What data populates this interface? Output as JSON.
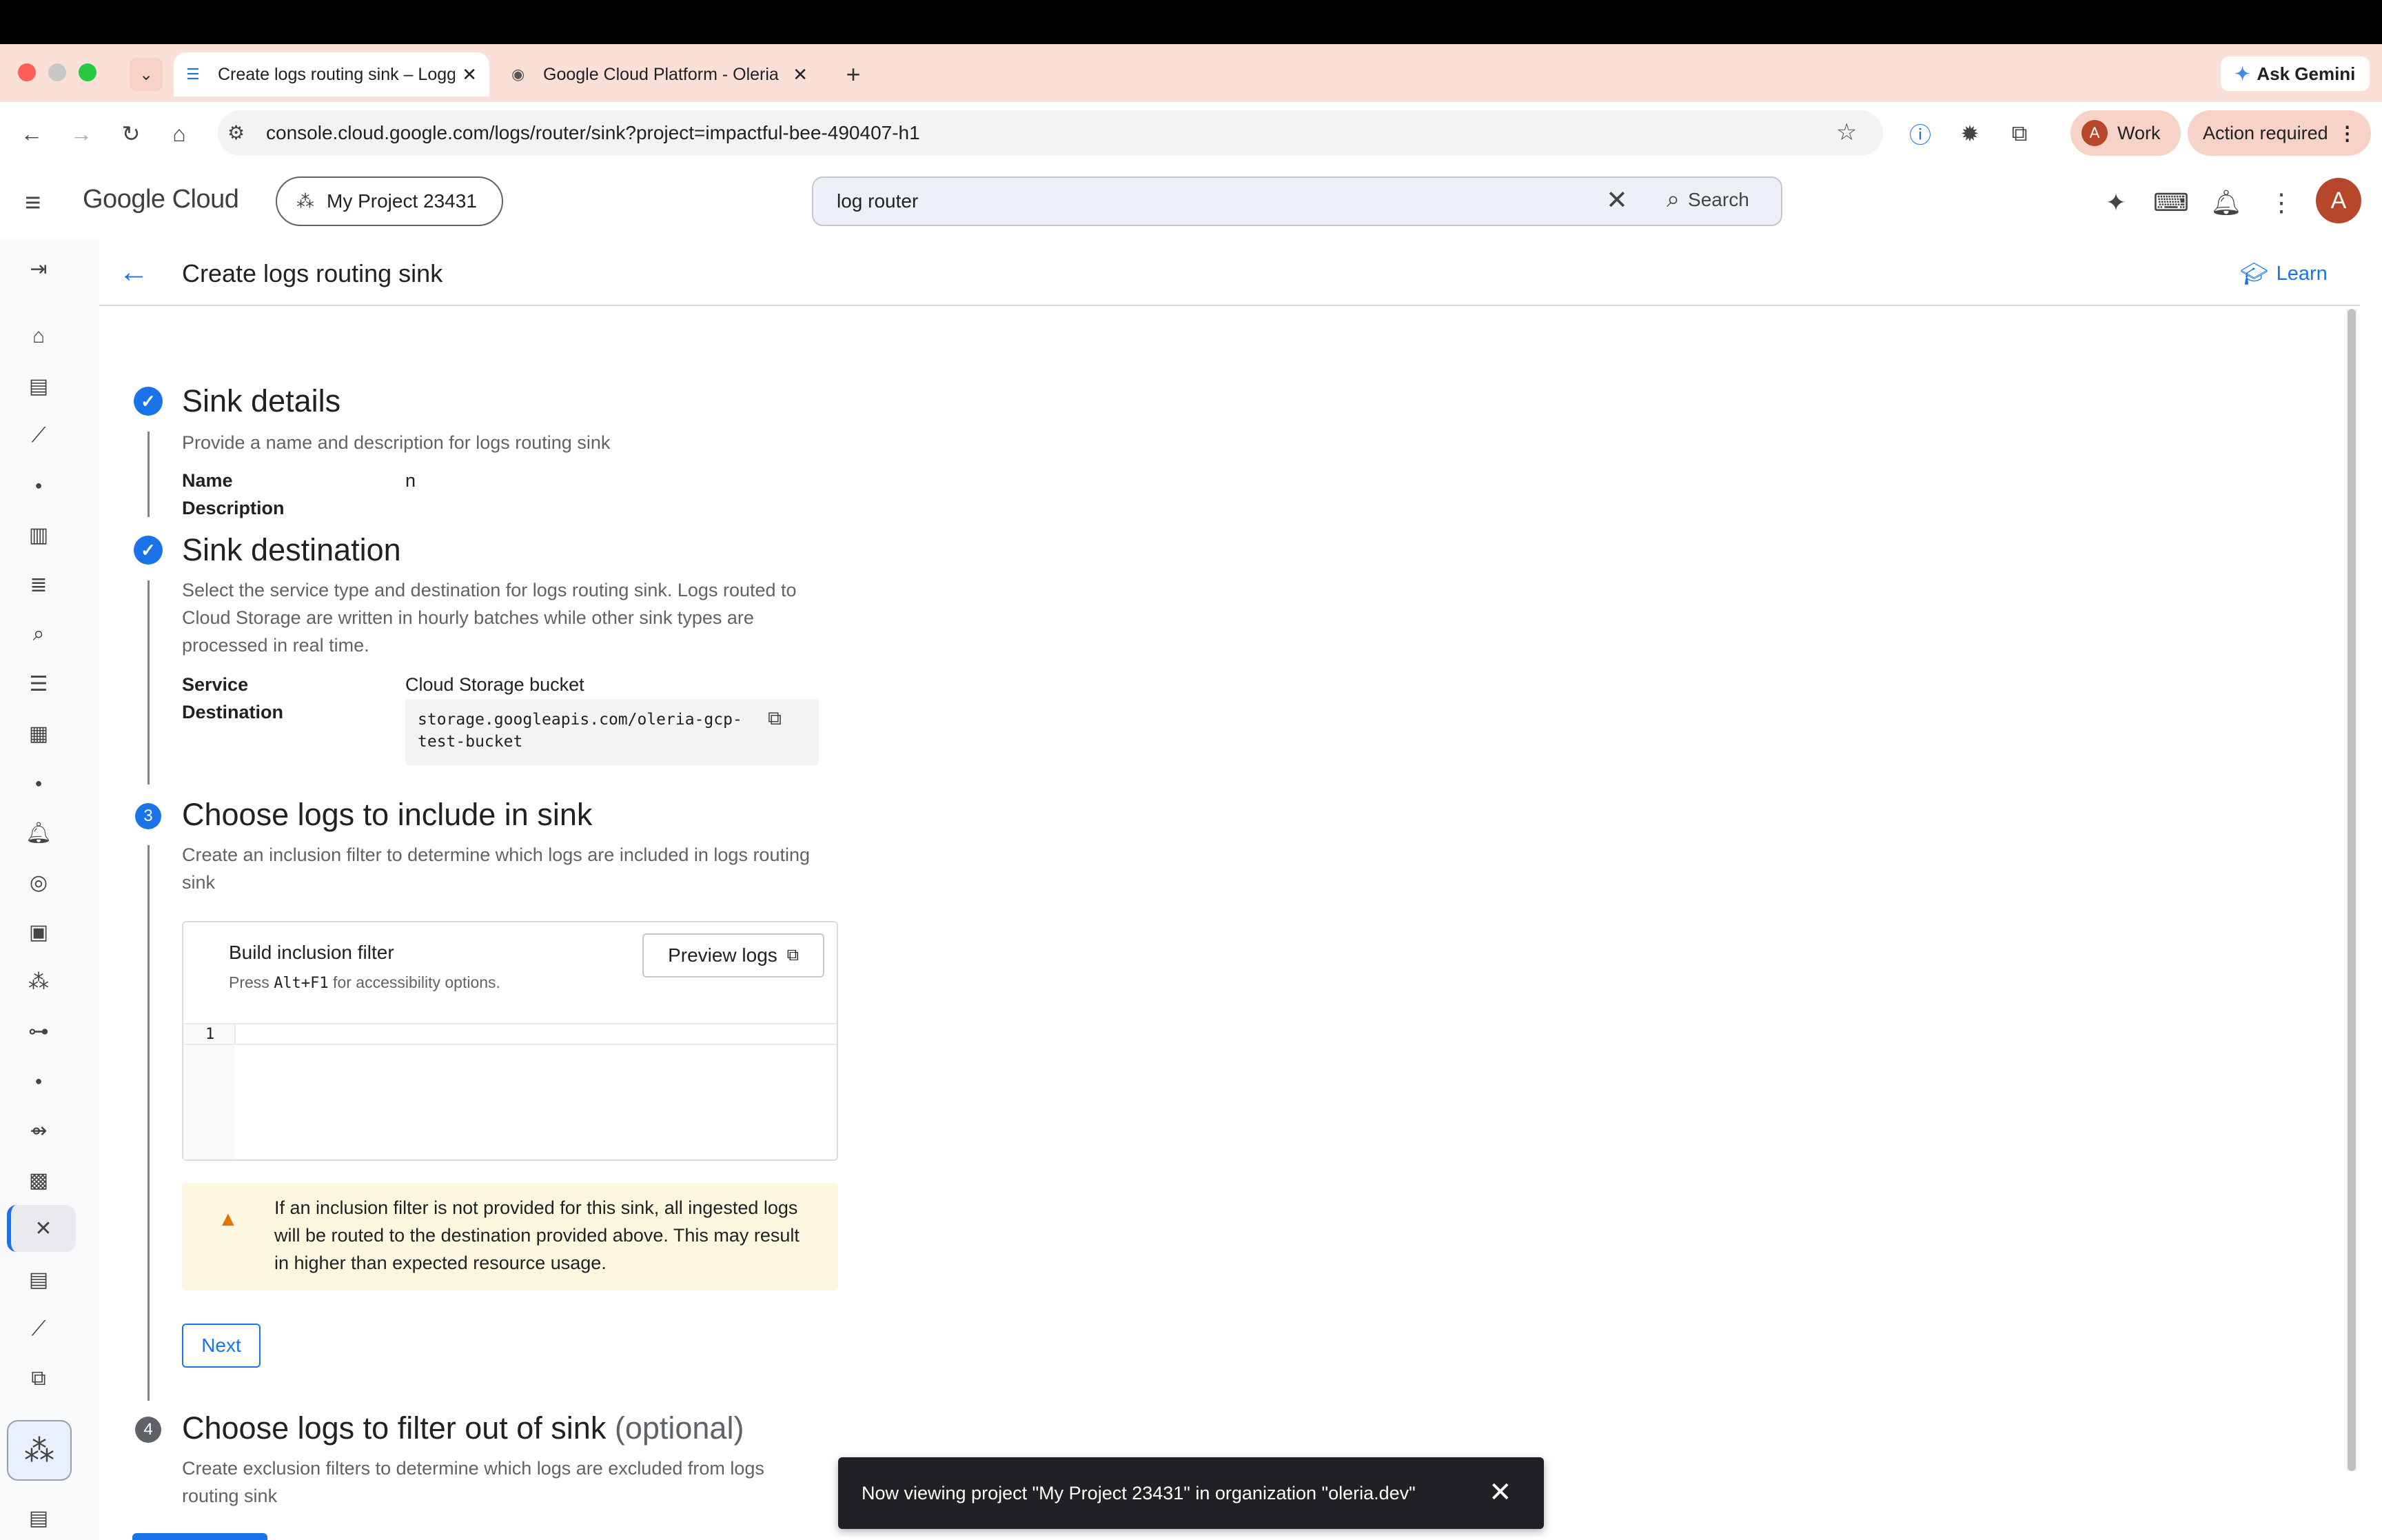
{
  "browser": {
    "tabs": [
      {
        "title": "Create logs routing sink – Logging",
        "icon": "list-icon",
        "close": "✕"
      },
      {
        "title": "Google Cloud Platform - Oleria",
        "icon": "eye-icon",
        "close": "✕"
      }
    ],
    "new_tab": "+",
    "ask_gemini": "Ask Gemini",
    "url": "console.cloud.google.com/logs/router/sink?project=impactful-bee-490407-h1",
    "profile_initial": "A",
    "profile_label": "Work",
    "action_required": "Action required"
  },
  "gcp_header": {
    "logo": "Google Cloud",
    "project": "My Project 23431",
    "search_value": "log router",
    "search_button": "Search",
    "user_initial": "A"
  },
  "page": {
    "title": "Create logs routing sink",
    "learn": "Learn"
  },
  "steps": {
    "sink_details": {
      "title": "Sink details",
      "description": "Provide a name and description for logs routing sink",
      "name_label": "Name",
      "name_value": "n",
      "description_label": "Description"
    },
    "sink_destination": {
      "title": "Sink destination",
      "description": "Select the service type and destination for logs routing sink. Logs routed to Cloud Storage are written in hourly batches while other sink types are processed in real time.",
      "service_label": "Service",
      "service_value": "Cloud Storage bucket",
      "destination_label": "Destination",
      "destination_value": "storage.googleapis.com/oleria-gcp-test-bucket"
    },
    "choose_logs": {
      "number": "3",
      "title": "Choose logs to include in sink",
      "description": "Create an inclusion filter to determine which logs are included in logs routing sink",
      "filter_title": "Build inclusion filter",
      "filter_hint_prefix": "Press ",
      "filter_hint_key": "Alt+F1",
      "filter_hint_suffix": " for accessibility options.",
      "preview_button": "Preview logs",
      "line_number": "1",
      "warning": "If an inclusion filter is not provided for this sink, all ingested logs will be routed to the destination provided above. This may result in higher than expected resource usage.",
      "next_button": "Next"
    },
    "filter_out": {
      "number": "4",
      "title": "Choose logs to filter out of sink",
      "optional": "(optional)",
      "description": "Create exclusion filters to determine which logs are excluded from logs routing sink"
    }
  },
  "snackbar": {
    "message": "Now viewing project \"My Project 23431\" in organization \"oleria.dev\""
  },
  "colors": {
    "accent": "#1a73e8",
    "tabstrip": "#fbe0d8",
    "warning_bg": "#fef7e0",
    "warning_icon": "#e37400"
  }
}
